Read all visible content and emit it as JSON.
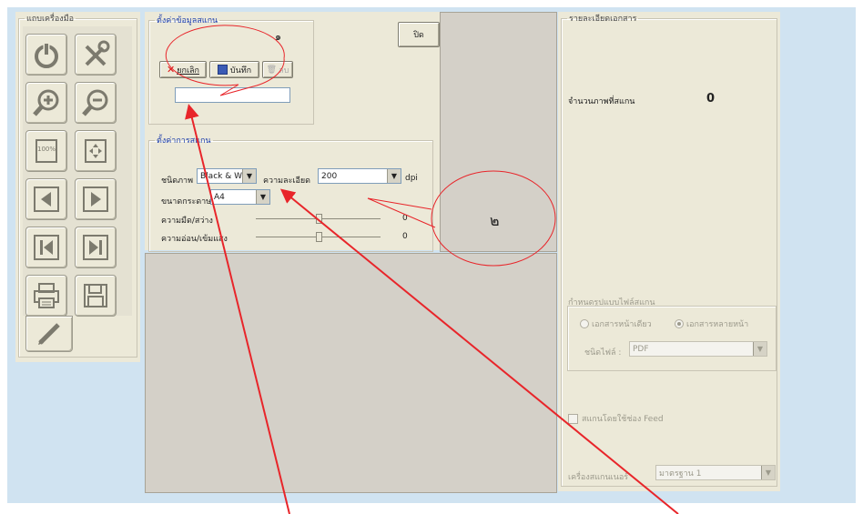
{
  "toolbar_panel": {
    "title": "แถบเครื่องมือ",
    "tools": [
      {
        "icon": "power-icon"
      },
      {
        "icon": "tools-icon"
      },
      {
        "icon": "zoom-in-icon"
      },
      {
        "icon": "zoom-out-icon"
      },
      {
        "icon": "zoom-100-icon",
        "text": "100%"
      },
      {
        "icon": "fit-page-icon"
      },
      {
        "icon": "prev-page-icon"
      },
      {
        "icon": "next-page-icon"
      },
      {
        "icon": "first-page-icon"
      },
      {
        "icon": "last-page-icon"
      },
      {
        "icon": "print-icon"
      },
      {
        "icon": "save-icon"
      },
      {
        "icon": "pen-icon"
      }
    ]
  },
  "close_button": {
    "label": "ปิด"
  },
  "scanner_settings": {
    "legend": "ตั้งค่าข้อมูลสแกน",
    "cancel_label": "ยกเลิก",
    "save_label": "บันทึก",
    "delete_label": "ลบ",
    "name_value": ""
  },
  "scan_settings": {
    "legend": "ตั้งค่าการสแกน",
    "image_type_label": "ชนิดภาพ",
    "image_type_value": "Black & Whi",
    "resolution_label": "ความละเอียด",
    "resolution_value": "200",
    "resolution_unit": "dpi",
    "paper_size_label": "ขนาดกระดาษ",
    "paper_size_value": "A4",
    "brightness_label": "ความมืด/สว่าง",
    "brightness_value": "0",
    "contrast_label": "ความอ่อน/เข้มแสง",
    "contrast_value": "0"
  },
  "document_panel": {
    "legend": "รายละเอียดเอกสาร",
    "page_count_label": "จำนวนภาพที่สแกน",
    "page_count_value": "0",
    "file_format_legend": "กำหนดรูปแบบไฟล์สแกน",
    "radio_single_label": "เอกสารหน้าเดียว",
    "radio_multi_label": "เอกสารหลายหน้า",
    "file_type_label": "ชนิดไฟล์ :",
    "file_type_value": "PDF",
    "feeder_label": "สแกนโดยใช้ช่อง Feed",
    "scanner_label": "เครื่องสแกนเนอร์",
    "scanner_value": "มาตรฐาน 1"
  },
  "annotations": {
    "callout_1": "๑",
    "callout_2": "๒"
  },
  "colors": {
    "window_bg": "#d0e3f1",
    "panel_bg": "#ece9d8",
    "annotation": "#e8252a"
  }
}
